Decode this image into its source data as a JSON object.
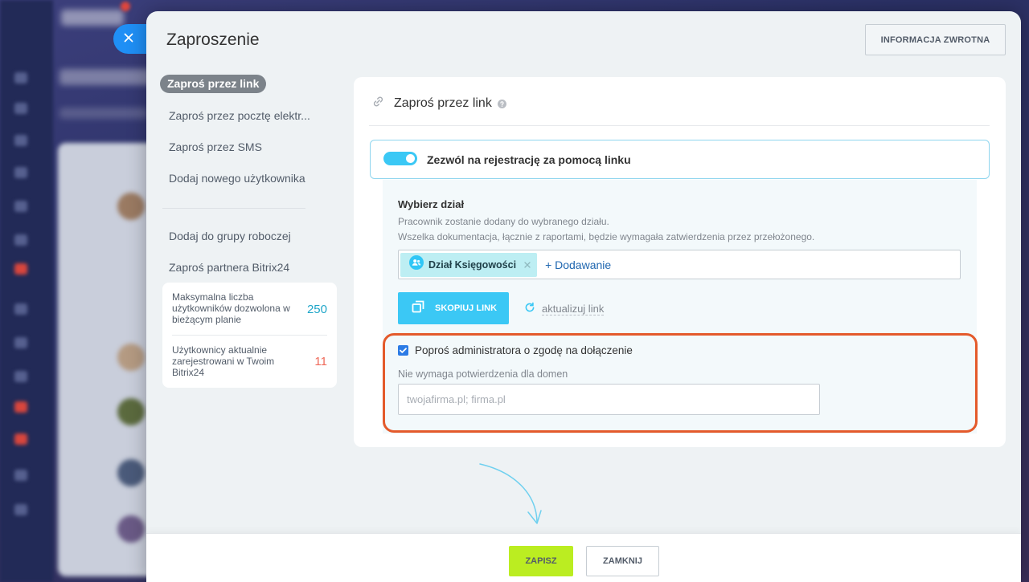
{
  "dialog": {
    "title": "Zaproszenie",
    "feedback_button": "INFORMACJA ZWROTNA"
  },
  "sidebar": {
    "items": [
      {
        "label": "Zaproś przez link",
        "active": true
      },
      {
        "label": "Zaproś przez pocztę elektr...",
        "active": false
      },
      {
        "label": "Zaproś przez SMS",
        "active": false
      },
      {
        "label": "Dodaj nowego użytkownika",
        "active": false
      },
      {
        "label": "Dodaj do grupy roboczej",
        "active": false
      },
      {
        "label": "Zaproś partnera Bitrix24",
        "active": false
      }
    ],
    "stats": [
      {
        "label": "Maksymalna liczba użytkowników dozwolona w bieżącym planie",
        "value": "250"
      },
      {
        "label": "Użytkownicy aktualnie zarejestrowani w Twoim Bitrix24",
        "value": "11"
      }
    ]
  },
  "link_invite": {
    "title": "Zaproś przez link",
    "registration_toggle": {
      "label": "Zezwól na rejestrację za pomocą linku",
      "enabled": true
    },
    "department": {
      "title": "Wybierz dział",
      "hint_lines": [
        "Pracownik zostanie dodany do wybranego działu.",
        "Wszelka dokumentacja, łącznie z raportami, będzie wymagała zatwierdzenia przez przełożonego."
      ],
      "selected": [
        "Dział Księgowości"
      ],
      "add_label": "+ Dodawanie"
    },
    "copy_link_button": "SKOPIUJ LINK",
    "refresh_link": "aktualizuj link",
    "admin_approval": {
      "label": "Poproś administratora o zgodę na dołączenie",
      "checked": true,
      "domains_label": "Nie wymaga potwierdzenia dla domen",
      "domains_placeholder": "twojafirma.pl; firma.pl",
      "domains_value": ""
    }
  },
  "footer": {
    "save_button": "ZAPISZ",
    "close_button": "ZAMKNIJ"
  },
  "icons": {
    "close": "close-icon",
    "link": "link-icon",
    "help": "help-icon",
    "department_tag": "users-icon",
    "remove_tag": "remove-icon",
    "copy": "copy-icon",
    "refresh": "refresh-icon",
    "checkbox": "checkbox-checked-icon"
  },
  "colors": {
    "accent": "#3bc8f5",
    "close_button": "#1f8ff5",
    "save_button": "#bbed21",
    "highlight_border": "#e45a2b",
    "tag_background": "#bdeef3",
    "max_users_value": "#20a6c9",
    "current_users_value": "#ef6a5a"
  }
}
